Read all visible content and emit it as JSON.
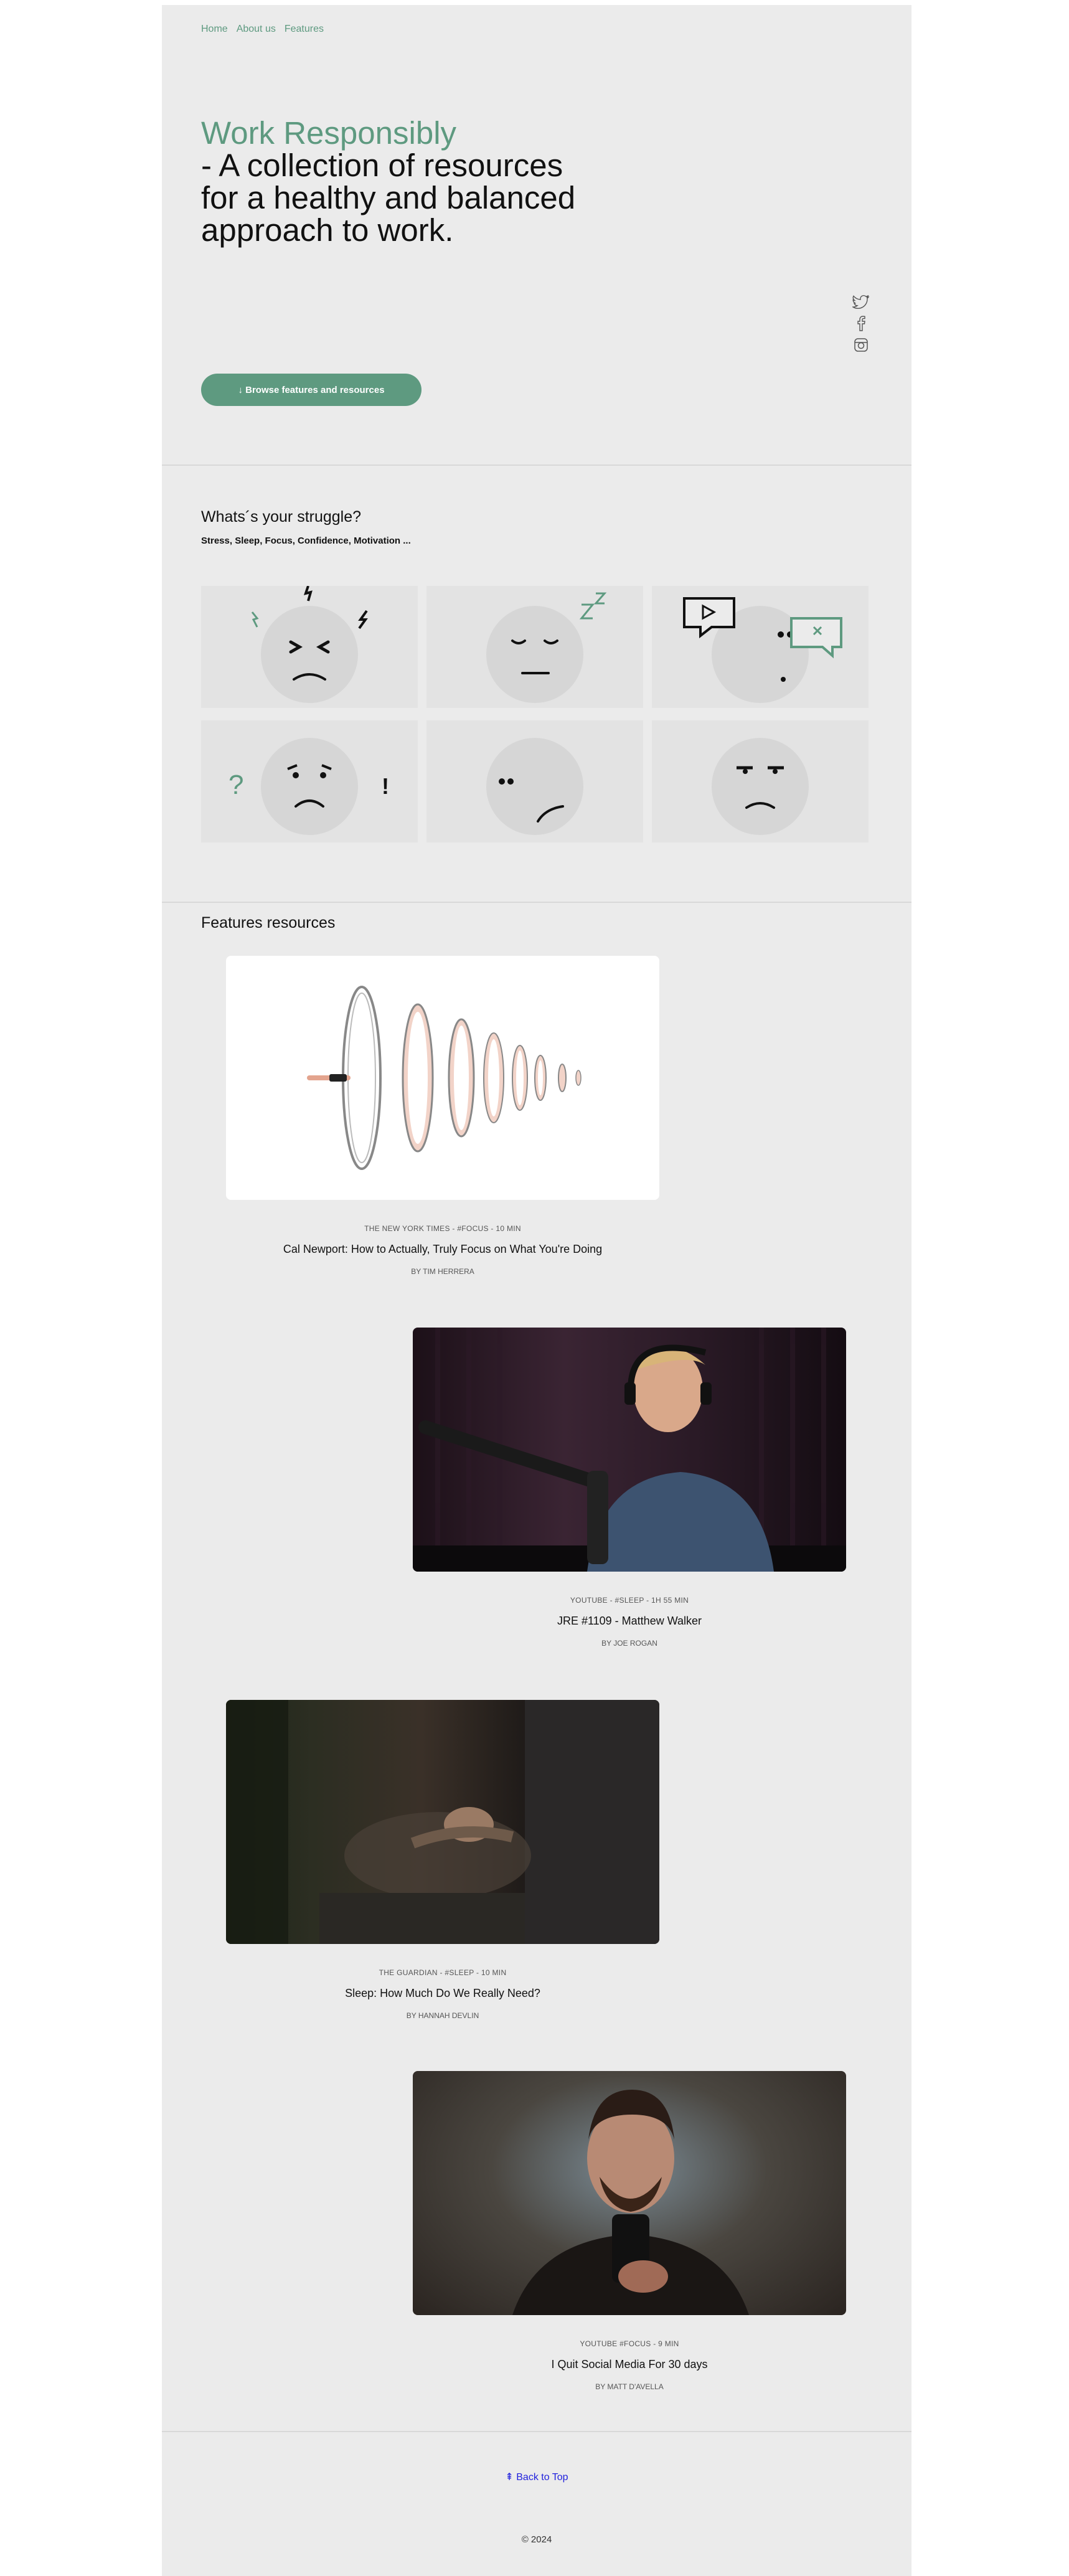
{
  "nav": {
    "home": "Home",
    "about": "About us",
    "features": "Features"
  },
  "hero": {
    "accent": "Work Responsibly",
    "rest": "- A collection of resources\nfor a healthy and balanced\napproach to work.",
    "button_label": "↓ Browse features and resources"
  },
  "social": [
    "twitter-icon",
    "facebook-icon",
    "instagram-icon"
  ],
  "struggle": {
    "title": "Whats´s your struggle?",
    "subtitle": "Stress, Sleep, Focus, Confidence, Motivation ..."
  },
  "features": {
    "title": "Features resources",
    "cards": [
      {
        "meta": "THE NEW YORK TIMES - #FOCUS - 10 MIN",
        "title": "Cal Newport: How to Actually, Truly Focus on What You're Doing",
        "author": "BY TIM HERRERA"
      },
      {
        "meta": "YOUTUBE - #SLEEP - 1H 55 MIN",
        "title": "JRE #1109 - Matthew Walker",
        "author": "BY JOE ROGAN"
      },
      {
        "meta": "THE GUARDIAN - #SLEEP - 10 MIN",
        "title": "Sleep: How Much Do We Really Need?",
        "author": "BY HANNAH DEVLIN"
      },
      {
        "meta": "YOUTUBE #FOCUS - 9 MIN",
        "title": "I Quit Social Media For 30 days",
        "author": "BY MATT D'AVELLA"
      }
    ]
  },
  "footer": {
    "back_to_top": "⇞ Back to Top",
    "copyright": "© 2024"
  },
  "colors": {
    "accent": "#5e9a80",
    "page_bg": "#ebebeb"
  }
}
